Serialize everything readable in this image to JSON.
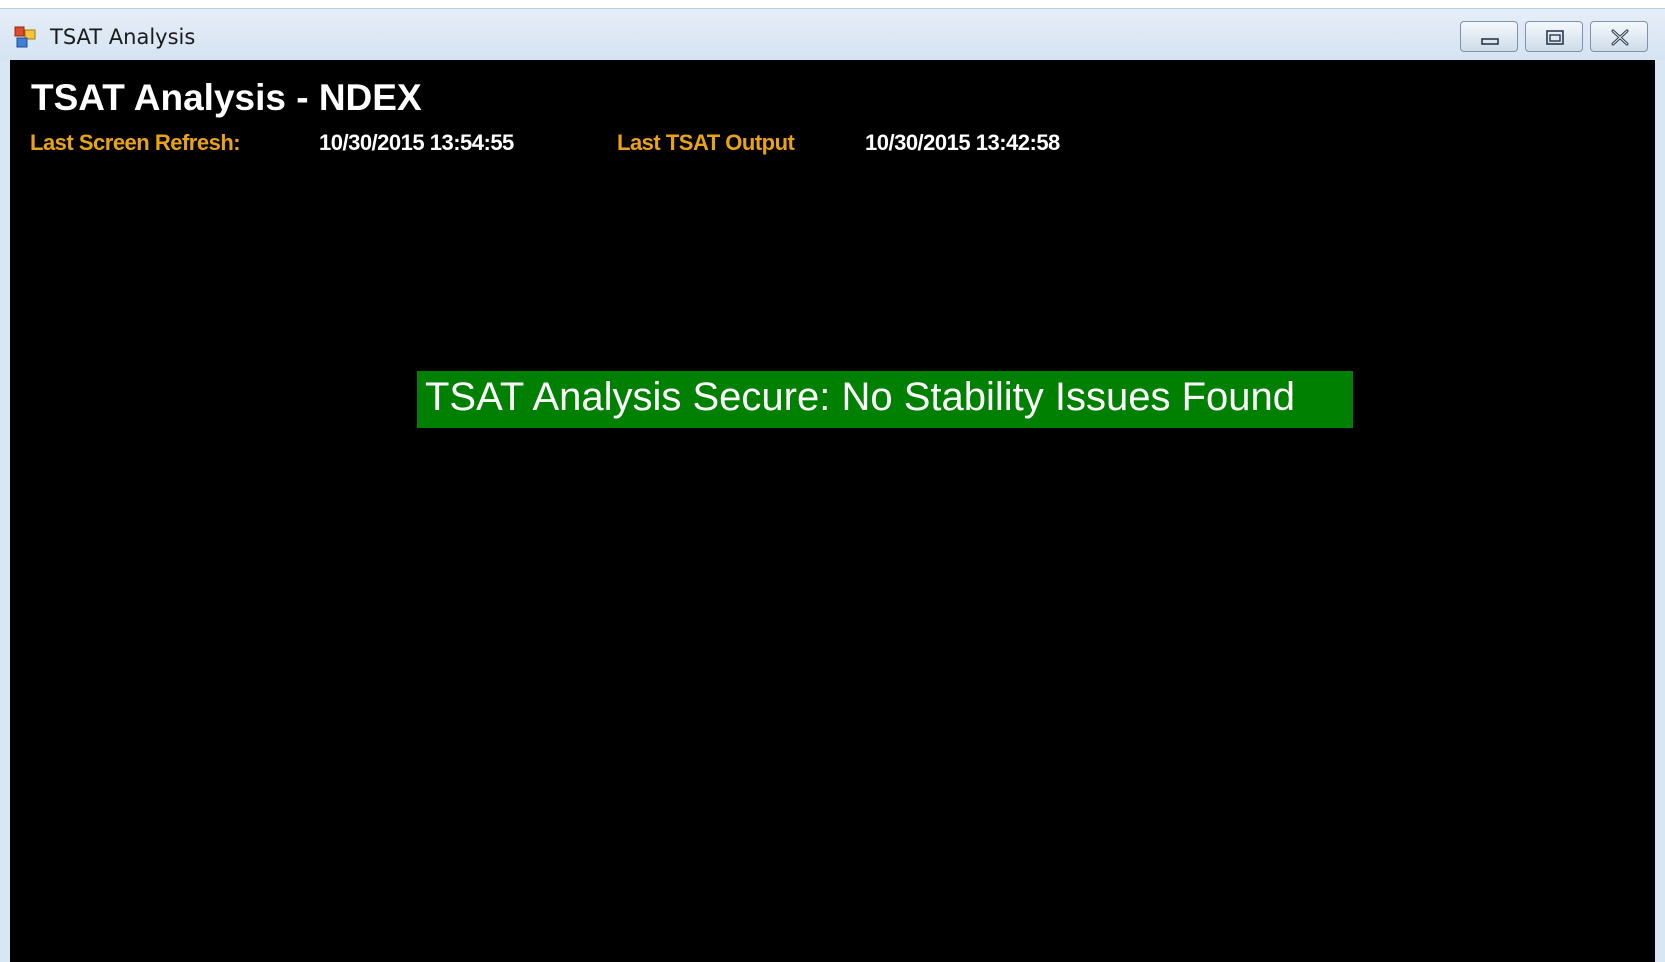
{
  "window": {
    "title": "TSAT Analysis",
    "icon": "app-window-icon",
    "controls": {
      "minimize_icon": "minimize-icon",
      "maximize_icon": "restore-icon",
      "close_icon": "close-icon"
    }
  },
  "main": {
    "heading": "TSAT Analysis - NDEX",
    "last_refresh_label": "Last Screen Refresh:",
    "last_refresh_value": "10/30/2015 13:54:55",
    "last_output_label": "Last TSAT Output",
    "last_output_value": "10/30/2015 13:42:58",
    "status_message": "TSAT Analysis Secure: No Stability Issues Found"
  },
  "colors": {
    "background": "#000000",
    "label": "#e8a317",
    "value": "#ffffff",
    "status_ok": "#008000"
  }
}
